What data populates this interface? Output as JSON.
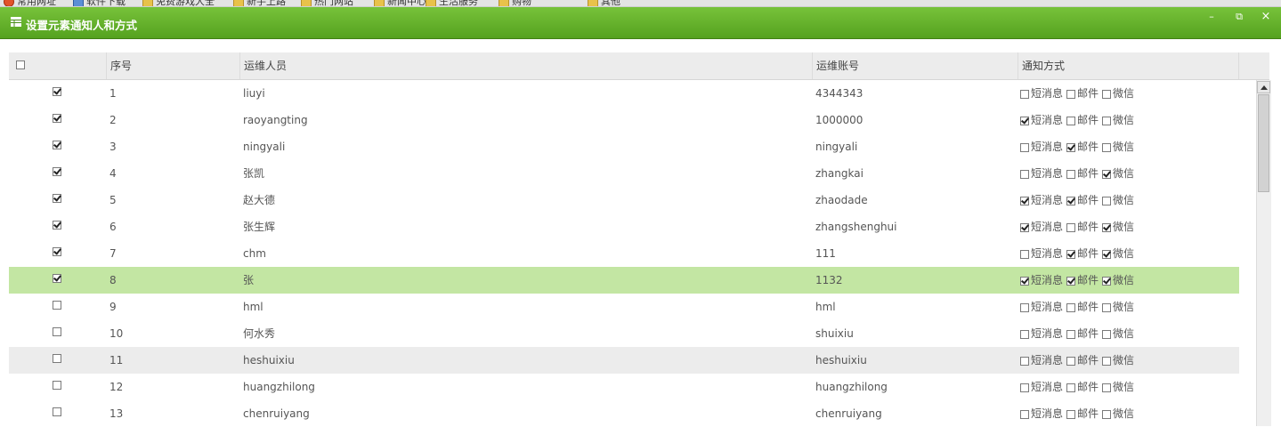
{
  "bookmarks": [
    "常用网址",
    "软件下载",
    "免费游戏大全",
    "新手上路",
    "热门网站",
    "新闻中心",
    "生活服务",
    "购物",
    "其他"
  ],
  "window": {
    "title": "设置元素通知人和方式",
    "min_label": "–",
    "restore_label": "⧉",
    "close_label": "×"
  },
  "grid": {
    "columns": [
      "序号",
      "运维人员",
      "运维账号",
      "通知方式"
    ],
    "method_labels": [
      "短消息",
      "邮件",
      "微信"
    ],
    "rows": [
      {
        "checked": true,
        "no": "1",
        "name": "liuyi",
        "account": "4344343",
        "sms": false,
        "mail": false,
        "wechat": false
      },
      {
        "checked": true,
        "no": "2",
        "name": "raoyangting",
        "account": "1000000",
        "sms": true,
        "mail": false,
        "wechat": false
      },
      {
        "checked": true,
        "no": "3",
        "name": "ningyali",
        "account": "ningyali",
        "sms": false,
        "mail": true,
        "wechat": false
      },
      {
        "checked": true,
        "no": "4",
        "name": "张凯",
        "account": "zhangkai",
        "sms": false,
        "mail": false,
        "wechat": true
      },
      {
        "checked": true,
        "no": "5",
        "name": "赵大德",
        "account": "zhaodade",
        "sms": true,
        "mail": true,
        "wechat": false
      },
      {
        "checked": true,
        "no": "6",
        "name": "张生辉",
        "account": "zhangshenghui",
        "sms": true,
        "mail": false,
        "wechat": true
      },
      {
        "checked": true,
        "no": "7",
        "name": "chm",
        "account": "111",
        "sms": false,
        "mail": true,
        "wechat": true
      },
      {
        "checked": true,
        "no": "8",
        "name": "张",
        "account": "1132",
        "sms": true,
        "mail": true,
        "wechat": true,
        "selected": true
      },
      {
        "checked": false,
        "no": "9",
        "name": "hml",
        "account": "hml",
        "sms": false,
        "mail": false,
        "wechat": false
      },
      {
        "checked": false,
        "no": "10",
        "name": "何水秀",
        "account": "shuixiu",
        "sms": false,
        "mail": false,
        "wechat": false
      },
      {
        "checked": false,
        "no": "11",
        "name": "heshuixiu",
        "account": "heshuixiu",
        "sms": false,
        "mail": false,
        "wechat": false,
        "alt": true
      },
      {
        "checked": false,
        "no": "12",
        "name": "huangzhilong",
        "account": "huangzhilong",
        "sms": false,
        "mail": false,
        "wechat": false
      },
      {
        "checked": false,
        "no": "13",
        "name": "chenruiyang",
        "account": "chenruiyang",
        "sms": false,
        "mail": false,
        "wechat": false
      }
    ]
  },
  "colors": {
    "titlebar": "#5aa626",
    "selected_row": "#c3e6a3",
    "header": "#ececec"
  }
}
